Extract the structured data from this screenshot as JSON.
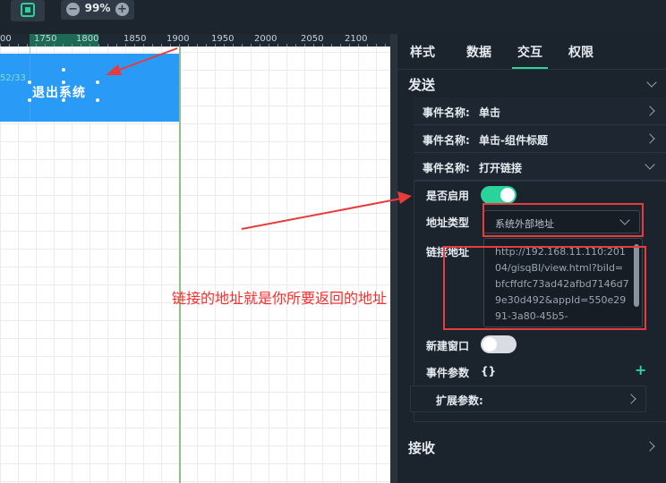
{
  "toolbar": {
    "zoom": "99%",
    "zoom_out": "−",
    "zoom_in": "+"
  },
  "ruler": {
    "ticks": [
      "00",
      "1750",
      "1800",
      "1850",
      "1900",
      "1950",
      "2000",
      "2050",
      "2100"
    ]
  },
  "canvas": {
    "coord_label": "52/33",
    "component_text": "退出系统"
  },
  "tabs": [
    "样式",
    "数据",
    "交互",
    "权限"
  ],
  "sections": {
    "send": "发送",
    "receive": "接收"
  },
  "events": [
    {
      "label": "事件名称:",
      "value": "单击"
    },
    {
      "label": "事件名称:",
      "value": "单击-组件标题"
    },
    {
      "label": "事件名称:",
      "value": "打开链接"
    }
  ],
  "link_settings": {
    "enabled_label": "是否启用",
    "address_type_label": "地址类型",
    "address_type_value": "系统外部地址",
    "link_label": "链接地址",
    "link_value": "http://192.168.11.110:20104/gisqBI/view.html?biId=bfcffdfc73ad42afbd7146d79e30d492&appId=550e2991-3a80-45b5-",
    "new_window_label": "新建窗口",
    "event_params_label": "事件参数",
    "event_params_value": "{}",
    "ext_params_label": "扩展参数:"
  },
  "annotation": "链接的地址就是你所要返回的地址",
  "colors": {
    "accent": "#29d49a",
    "annotation": "#ff2a2a",
    "component_bg": "#2a9af7"
  }
}
